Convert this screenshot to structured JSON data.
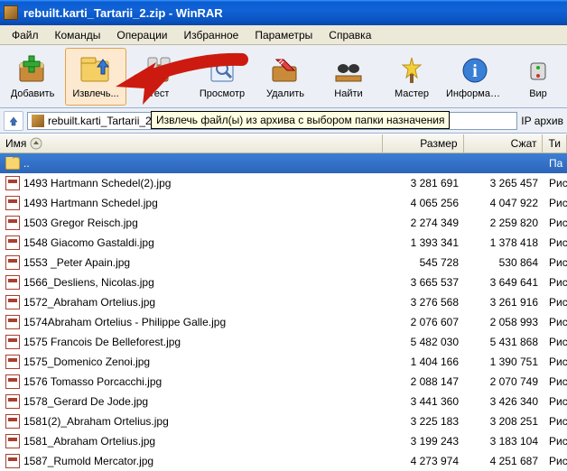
{
  "title": "rebuilt.karti_Tartarii_2.zip - WinRAR",
  "menu": [
    "Файл",
    "Команды",
    "Операции",
    "Избранное",
    "Параметры",
    "Справка"
  ],
  "toolbar": [
    {
      "label": "Добавить",
      "icon": "add"
    },
    {
      "label": "Извлечь...",
      "icon": "extract",
      "hover": true
    },
    {
      "label": "Тест",
      "icon": "test"
    },
    {
      "label": "Просмотр",
      "icon": "view"
    },
    {
      "label": "Удалить",
      "icon": "delete"
    },
    {
      "label": "Найти",
      "icon": "find"
    },
    {
      "label": "Мастер",
      "icon": "wizard"
    },
    {
      "label": "Информация",
      "icon": "info"
    },
    {
      "label": "Вир",
      "icon": "virus"
    }
  ],
  "tooltip": "Извлечь файл(ы) из архива с выбором папки назначения",
  "address": "rebuilt.karti_Tartarii_2.zip",
  "address_tail": "IP архив",
  "headers": {
    "name": "Имя",
    "size": "Размер",
    "packed": "Сжат",
    "type": "Ти"
  },
  "parent": {
    "name": "..",
    "type": "Па"
  },
  "files": [
    {
      "name": "1493 Hartmann Schedel(2).jpg",
      "size": "3 281 691",
      "packed": "3 265 457",
      "type": "Рис"
    },
    {
      "name": "1493 Hartmann Schedel.jpg",
      "size": "4 065 256",
      "packed": "4 047 922",
      "type": "Рис"
    },
    {
      "name": "1503 Gregor Reisch.jpg",
      "size": "2 274 349",
      "packed": "2 259 820",
      "type": "Рис"
    },
    {
      "name": "1548 Giacomo Gastaldi.jpg",
      "size": "1 393 341",
      "packed": "1 378 418",
      "type": "Рис"
    },
    {
      "name": "1553 _Peter Apain.jpg",
      "size": "545 728",
      "packed": "530 864",
      "type": "Рис"
    },
    {
      "name": "1566_Desliens, Nicolas.jpg",
      "size": "3 665 537",
      "packed": "3 649 641",
      "type": "Рис"
    },
    {
      "name": "1572_Abraham Ortelius.jpg",
      "size": "3 276 568",
      "packed": "3 261 916",
      "type": "Рис"
    },
    {
      "name": "1574Abraham Ortelius - Philippe Galle.jpg",
      "size": "2 076 607",
      "packed": "2 058 993",
      "type": "Рис"
    },
    {
      "name": "1575 Francois De Belleforest.jpg",
      "size": "5 482 030",
      "packed": "5 431 868",
      "type": "Рис"
    },
    {
      "name": "1575_Domenico Zenoi.jpg",
      "size": "1 404 166",
      "packed": "1 390 751",
      "type": "Рис"
    },
    {
      "name": "1576 Tomasso Porcacchi.jpg",
      "size": "2 088 147",
      "packed": "2 070 749",
      "type": "Рис"
    },
    {
      "name": "1578_Gerard De Jode.jpg",
      "size": "3 441 360",
      "packed": "3 426 340",
      "type": "Рис"
    },
    {
      "name": "1581(2)_Abraham Ortelius.jpg",
      "size": "3 225 183",
      "packed": "3 208 251",
      "type": "Рис"
    },
    {
      "name": "1581_Abraham Ortelius.jpg",
      "size": "3 199 243",
      "packed": "3 183 104",
      "type": "Рис"
    },
    {
      "name": "1587_Rumold Mercator.jpg",
      "size": "4 273 974",
      "packed": "4 251 687",
      "type": "Рис"
    }
  ]
}
